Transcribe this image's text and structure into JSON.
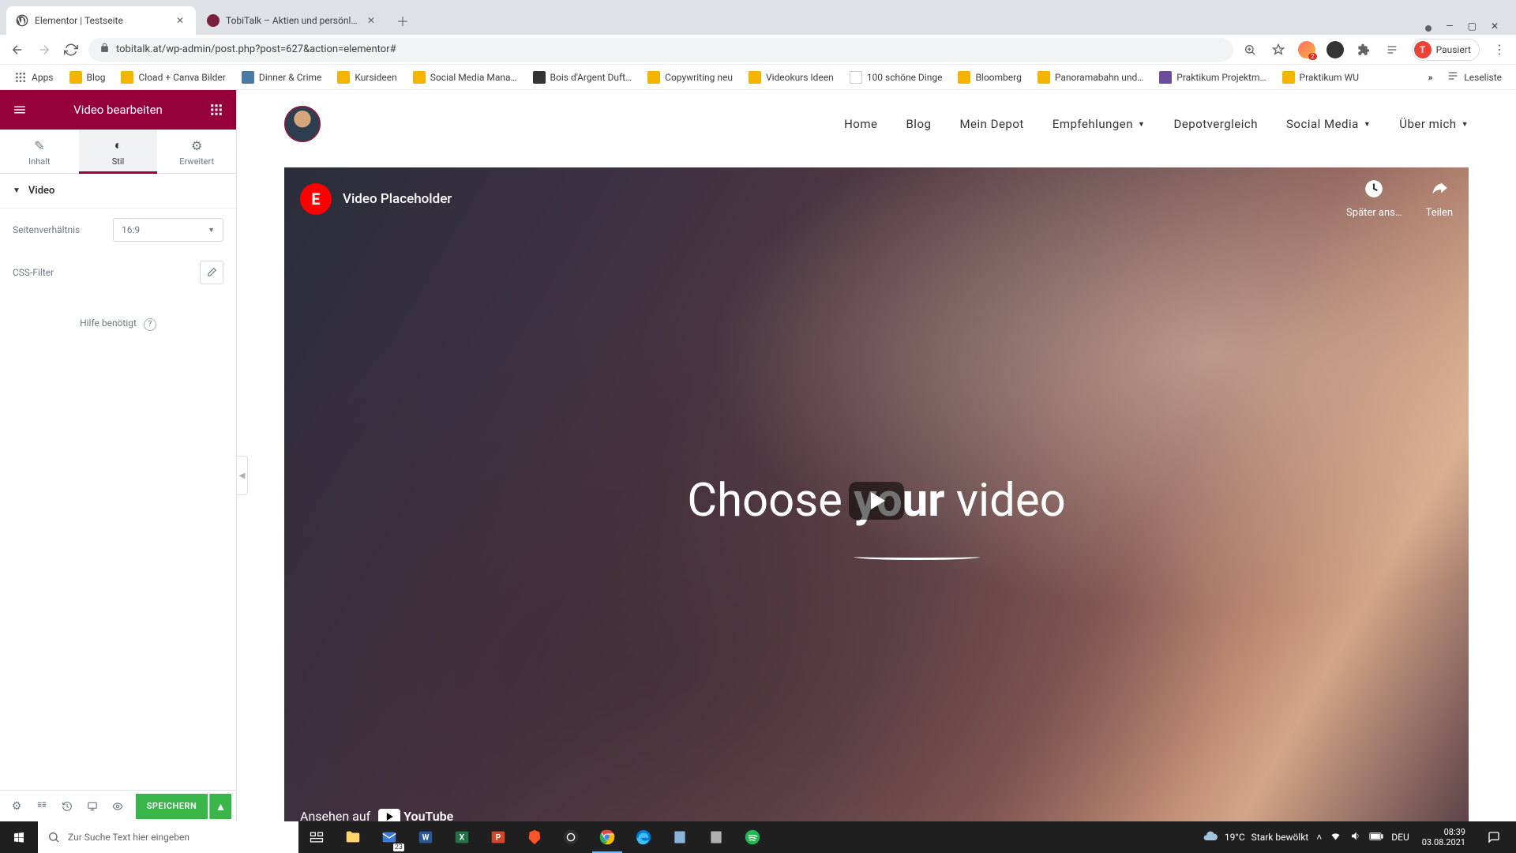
{
  "browser": {
    "tabs": [
      {
        "title": "Elementor | Testseite",
        "active": true
      },
      {
        "title": "TobiTalk – Aktien und persönlich…",
        "active": false
      }
    ],
    "url": "tobitalk.at/wp-admin/post.php?post=627&action=elementor#",
    "profile_label": "Pausiert",
    "profile_initial": "T",
    "bookmarks": {
      "apps": "Apps",
      "items": [
        "Blog",
        "Cload + Canva Bilder",
        "Dinner & Crime",
        "Kursideen",
        "Social Media Mana…",
        "Bois d'Argent Duft…",
        "Copywriting neu",
        "Videokurs Ideen",
        "100 schöne Dinge",
        "Bloomberg",
        "Panoramabahn und…",
        "Praktikum Projektm…",
        "Praktikum WU"
      ],
      "reading_list": "Leseliste"
    }
  },
  "sidebar": {
    "title": "Video bearbeiten",
    "tabs": {
      "content": "Inhalt",
      "style": "Stil",
      "advanced": "Erweitert"
    },
    "section_video": "Video",
    "aspect_label": "Seitenverhältnis",
    "aspect_value": "16:9",
    "css_filter_label": "CSS-Filter",
    "help_label": "Hilfe benötigt",
    "save_label": "SPEICHERN"
  },
  "site": {
    "nav": {
      "home": "Home",
      "blog": "Blog",
      "depot": "Mein Depot",
      "empf": "Empfehlungen",
      "vergleich": "Depotvergleich",
      "social": "Social Media",
      "about": "Über mich"
    },
    "video": {
      "title": "Video Placeholder",
      "watch_later": "Später ans…",
      "share": "Teilen",
      "overlay_prefix": "Choose ",
      "overlay_bold": "your",
      "overlay_suffix": " video",
      "watch_on": "Ansehen auf",
      "youtube": "YouTube"
    }
  },
  "taskbar": {
    "search_placeholder": "Zur Suche Text hier eingeben",
    "weather_temp": "19°C",
    "weather_desc": "Stark bewölkt",
    "lang": "DEU",
    "time": "08:39",
    "date": "03.08.2021",
    "calendar_badge": "23"
  }
}
